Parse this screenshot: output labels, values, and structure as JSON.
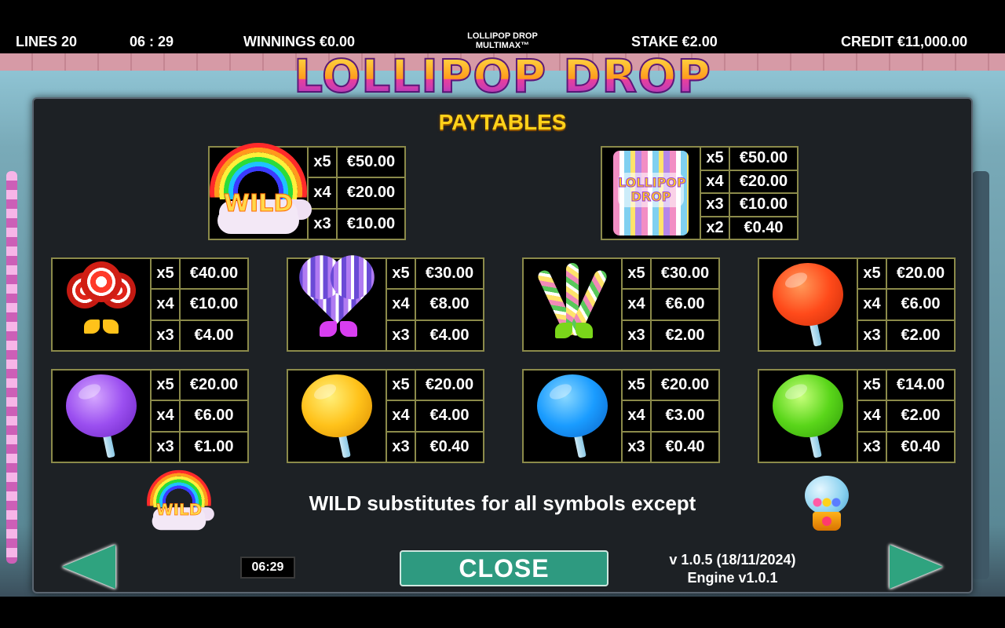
{
  "status_bar": {
    "lines": "LINES 20",
    "time": "06 : 29",
    "winnings": "WINNINGS €0.00",
    "game_name_line1": "LOLLIPOP DROP",
    "game_name_line2": "MULTIMAX™",
    "stake": "STAKE €2.00",
    "credit": "CREDIT €11,000.00"
  },
  "logo": "LOLLIPOP DROP",
  "paytable": {
    "title": "PAYTABLES",
    "symbols": [
      {
        "symbol": "wild-rainbow",
        "wild_label": "WILD",
        "pays": [
          {
            "m": "x5",
            "v": "€50.00"
          },
          {
            "m": "x4",
            "v": "€20.00"
          },
          {
            "m": "x3",
            "v": "€10.00"
          }
        ]
      },
      {
        "symbol": "candy-bag",
        "bag_label_1": "LOLLIPOP",
        "bag_label_2": "DROP",
        "pays": [
          {
            "m": "x5",
            "v": "€50.00"
          },
          {
            "m": "x4",
            "v": "€20.00"
          },
          {
            "m": "x3",
            "v": "€10.00"
          },
          {
            "m": "x2",
            "v": "€0.40"
          }
        ]
      },
      {
        "symbol": "red-swirl-lollipops",
        "pays": [
          {
            "m": "x5",
            "v": "€40.00"
          },
          {
            "m": "x4",
            "v": "€10.00"
          },
          {
            "m": "x3",
            "v": "€4.00"
          }
        ]
      },
      {
        "symbol": "purple-heart-lollipop",
        "pays": [
          {
            "m": "x5",
            "v": "€30.00"
          },
          {
            "m": "x4",
            "v": "€8.00"
          },
          {
            "m": "x3",
            "v": "€4.00"
          }
        ]
      },
      {
        "symbol": "candy-canes",
        "pays": [
          {
            "m": "x5",
            "v": "€30.00"
          },
          {
            "m": "x4",
            "v": "€6.00"
          },
          {
            "m": "x3",
            "v": "€2.00"
          }
        ]
      },
      {
        "symbol": "red-lollipop",
        "color": "#ff4a1a",
        "pays": [
          {
            "m": "x5",
            "v": "€20.00"
          },
          {
            "m": "x4",
            "v": "€6.00"
          },
          {
            "m": "x3",
            "v": "€2.00"
          }
        ]
      },
      {
        "symbol": "purple-lollipop",
        "color": "#9b4ff0",
        "pays": [
          {
            "m": "x5",
            "v": "€20.00"
          },
          {
            "m": "x4",
            "v": "€6.00"
          },
          {
            "m": "x3",
            "v": "€1.00"
          }
        ]
      },
      {
        "symbol": "yellow-lollipop",
        "color": "#ffc21a",
        "pays": [
          {
            "m": "x5",
            "v": "€20.00"
          },
          {
            "m": "x4",
            "v": "€4.00"
          },
          {
            "m": "x3",
            "v": "€0.40"
          }
        ]
      },
      {
        "symbol": "blue-lollipop",
        "color": "#1a9cff",
        "pays": [
          {
            "m": "x5",
            "v": "€20.00"
          },
          {
            "m": "x4",
            "v": "€3.00"
          },
          {
            "m": "x3",
            "v": "€0.40"
          }
        ]
      },
      {
        "symbol": "green-lollipop",
        "color": "#5ad61a",
        "pays": [
          {
            "m": "x5",
            "v": "€14.00"
          },
          {
            "m": "x4",
            "v": "€2.00"
          },
          {
            "m": "x3",
            "v": "€0.40"
          }
        ]
      }
    ],
    "wild_note": "WILD substitutes for all symbols except",
    "wild_small_label": "WILD"
  },
  "footer": {
    "clock": "06:29",
    "close_label": "CLOSE",
    "version": "v 1.0.5 (18/11/2024)",
    "engine": "Engine v1.0.1"
  }
}
